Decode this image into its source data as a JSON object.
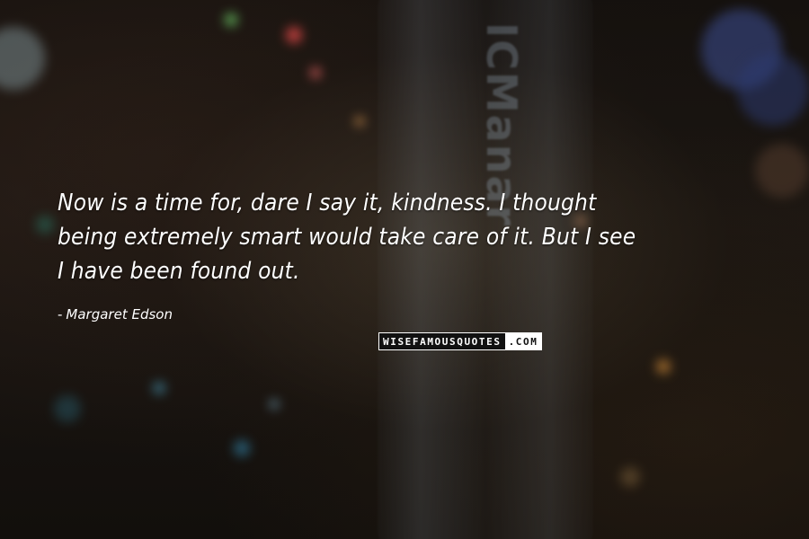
{
  "quote": {
    "lines": [
      "Now is a time for, dare I say it, kindness. I thought",
      "being extremely smart would take care of it. But I see",
      "I have been found out."
    ]
  },
  "author": {
    "dash": "-",
    "name": "Margaret Edson"
  },
  "watermark": {
    "main": "WISEFAMOUSQUOTES",
    "suffix": ".COM"
  },
  "background": {
    "glass_text": "ICManar"
  },
  "colors": {
    "text": "#ffffff",
    "background": "#15110e"
  }
}
